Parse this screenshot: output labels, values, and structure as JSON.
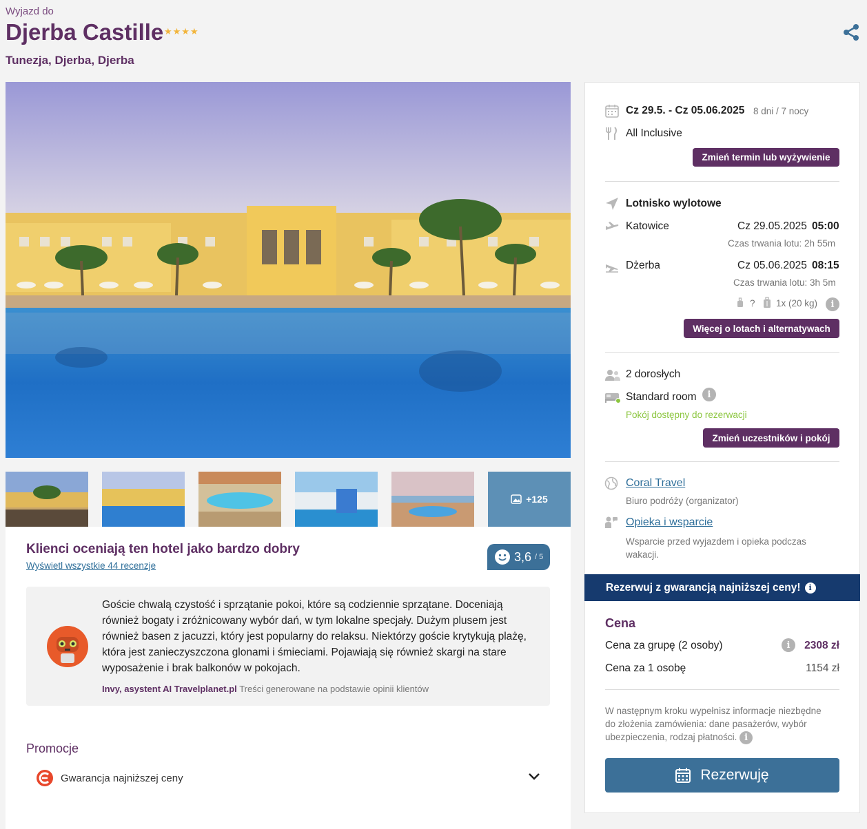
{
  "header": {
    "pre_title": "Wyjazd do",
    "hotel_name": "Djerba Castille",
    "stars": "★★★★",
    "location": "Tunezja, Djerba, Djerba"
  },
  "gallery": {
    "more_label": "+125"
  },
  "rating": {
    "title": "Klienci oceniają ten hotel jako bardzo dobry",
    "reviews_link": "Wyświetl wszystkie 44 recenzje",
    "score": "3,6",
    "scale": "/ 5"
  },
  "ai_summary": {
    "text": "Goście chwalą czystość i sprzątanie pokoi, które są codziennie sprzątane. Doceniają również bogaty i zróżnicowany wybór dań, w tym lokalne specjały. Dużym plusem jest również basen z jacuzzi, który jest popularny do relaksu. Niektórzy goście krytykują plażę, która jest zanieczyszczona glonami i śmieciami. Pojawiają się również skargi na stare wyposażenie i brak balkonów w pokojach.",
    "author": "Invy, asystent AI Travelplanet.pl",
    "note": "Treści generowane na podstawie opinii klientów"
  },
  "promotions": {
    "title": "Promocje",
    "items": [
      {
        "label": "Gwarancja najniższej ceny"
      }
    ]
  },
  "booking": {
    "dates": "Cz 29.5. - Cz 05.06.2025",
    "duration": "8 dni / 7 nocy",
    "board": "All Inclusive",
    "change_term_button": "Zmień termin lub wyżywienie",
    "airport_label": "Lotnisko wylotowe",
    "outbound": {
      "city": "Katowice",
      "date": "Cz 29.05.2025",
      "time": "05:00",
      "duration": "Czas trwania lotu: 2h 55m"
    },
    "inbound": {
      "city": "Dżerba",
      "date": "Cz 05.06.2025",
      "time": "08:15",
      "duration": "Czas trwania lotu: 3h 5m"
    },
    "baggage_cabin": "?",
    "baggage_hold": "1x (20 kg)",
    "flights_button": "Więcej o lotach i alternatywach",
    "participants": "2 dorosłych",
    "room": "Standard room",
    "room_status": "Pokój dostępny do rezerwacji",
    "change_room_button": "Zmień uczestników i pokój",
    "organizer_name": "Coral Travel",
    "organizer_desc": "Biuro podróży (organizator)",
    "support_link": "Opieka i wsparcie",
    "support_desc": "Wsparcie przed wyjazdem i opieka podczas wakacji.",
    "guarantee_banner": "Rezerwuj z gwarancją najniższej ceny!",
    "price_title": "Cena",
    "price_group_label": "Cena za grupę (2 osoby)",
    "price_group_value": "2308 zł",
    "price_person_label": "Cena za 1 osobę",
    "price_person_value": "1154 zł",
    "next_step_note": "W następnym kroku wypełnisz informacje niezbędne do złożenia zamówienia: dane pasażerów, wybór ubezpieczenia, rodzaj płatności.",
    "book_button": "Rezerwuję"
  },
  "colors": {
    "brand_purple": "#5e2f63",
    "brand_blue": "#3c7098",
    "banner_navy": "#163a6e",
    "available_green": "#8cc63f"
  }
}
